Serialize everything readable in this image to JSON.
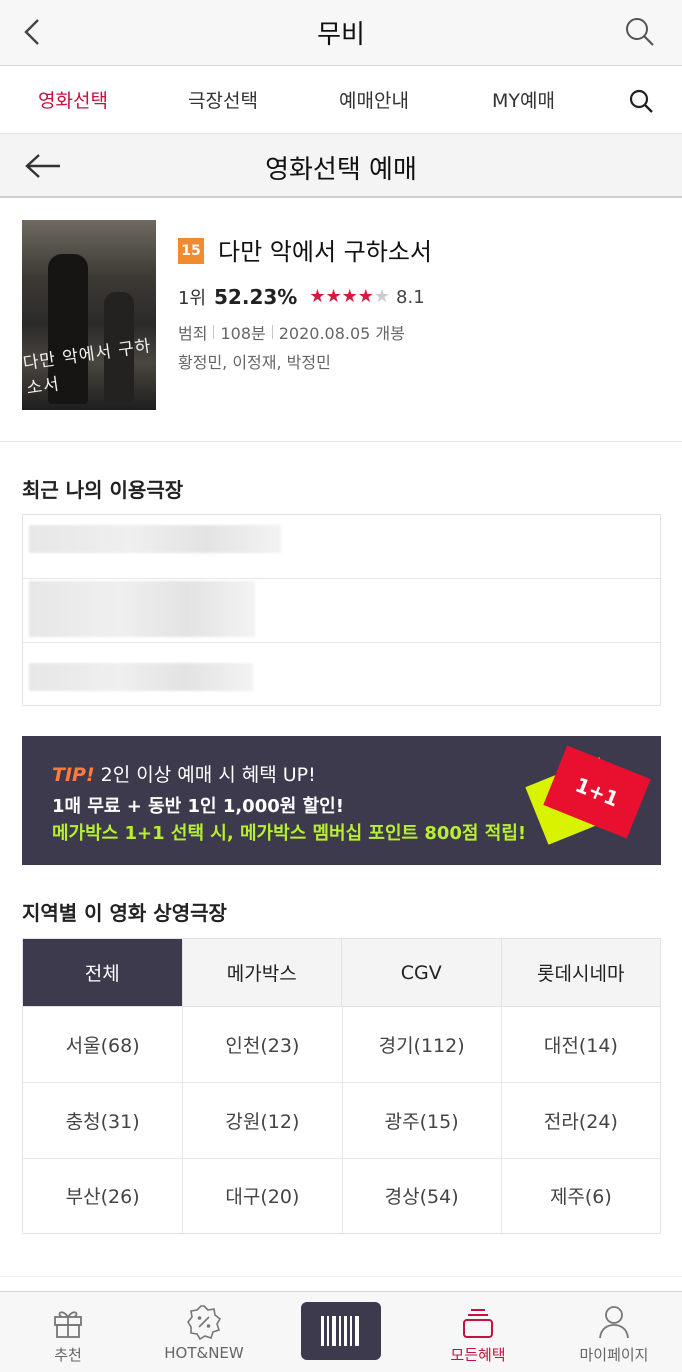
{
  "app_header": {
    "title": "무비"
  },
  "tabs": [
    {
      "label": "영화선택",
      "active": true
    },
    {
      "label": "극장선택",
      "active": false
    },
    {
      "label": "예매안내",
      "active": false
    },
    {
      "label": "MY예매",
      "active": false
    }
  ],
  "sub_header": {
    "title": "영화선택 예매"
  },
  "movie": {
    "age_rating": "15",
    "title": "다만 악에서 구하소서",
    "rank": "1위",
    "booking_rate": "52.23%",
    "star_rating": 4,
    "score": "8.1",
    "genre": "범죄",
    "runtime": "108분",
    "release": "2020.08.05 개봉",
    "cast": "황정민, 이정재, 박정민",
    "poster_title": "다만 악에서 구하소서"
  },
  "recent": {
    "title": "최근 나의 이용극장"
  },
  "banner": {
    "tip": "TIP!",
    "line1": "2인 이상 예매 시 혜택 UP!",
    "line2": "1매 무료 + 동반 1인 1,000원 할인!",
    "line3": "메가박스 1+1 선택 시, 메가박스 멤버십 포인트 800점 적립!",
    "ticket_text": "1+1"
  },
  "regions": {
    "title": "지역별 이 영화 상영극장",
    "tabs": [
      {
        "label": "전체",
        "active": true
      },
      {
        "label": "메가박스",
        "active": false
      },
      {
        "label": "CGV",
        "active": false
      },
      {
        "label": "롯데시네마",
        "active": false
      }
    ],
    "cells": [
      "서울(68)",
      "인천(23)",
      "경기(112)",
      "대전(14)",
      "충청(31)",
      "강원(12)",
      "광주(15)",
      "전라(24)",
      "부산(26)",
      "대구(20)",
      "경상(54)",
      "제주(6)"
    ]
  },
  "bottom_nav": [
    {
      "label": "추천",
      "icon": "gift-icon"
    },
    {
      "label": "HOT&NEW",
      "icon": "percent-badge-icon"
    },
    {
      "label": "모든혜택",
      "icon": "stack-icon",
      "active": true
    },
    {
      "label": "마이페이지",
      "icon": "person-icon"
    }
  ],
  "colors": {
    "accent": "#c4133f",
    "dark": "#3e3a4d",
    "badge": "#f18b2f",
    "banner_green": "#b7f030"
  }
}
